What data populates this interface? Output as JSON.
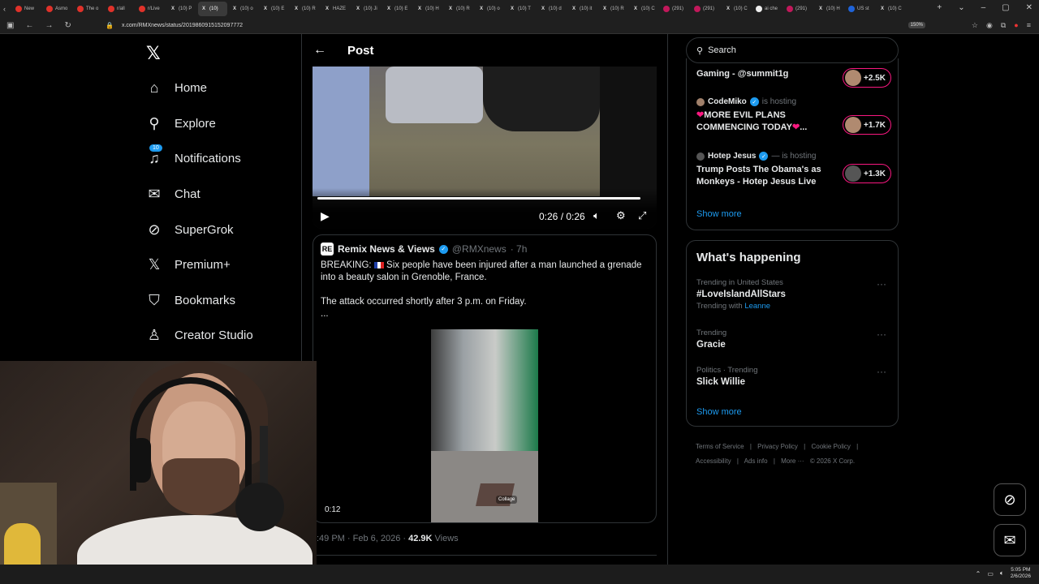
{
  "browser": {
    "tabs": [
      {
        "label": "New",
        "fav": "red"
      },
      {
        "label": "Asmo",
        "fav": "red"
      },
      {
        "label": "The o",
        "fav": "red"
      },
      {
        "label": "r/all",
        "fav": "red"
      },
      {
        "label": "r/Live",
        "fav": "red"
      },
      {
        "label": "(10) P",
        "fav": "x"
      },
      {
        "label": "(10)",
        "fav": "x",
        "active": true
      },
      {
        "label": "(10) o",
        "fav": "x"
      },
      {
        "label": "(10) E",
        "fav": "x"
      },
      {
        "label": "(10) R",
        "fav": "x"
      },
      {
        "label": "HAZE",
        "fav": "x"
      },
      {
        "label": "(10) Ji",
        "fav": "x"
      },
      {
        "label": "(10) E",
        "fav": "x"
      },
      {
        "label": "(10) H",
        "fav": "x"
      },
      {
        "label": "(10) R",
        "fav": "x"
      },
      {
        "label": "(10) o",
        "fav": "x"
      },
      {
        "label": "(10) T",
        "fav": "x"
      },
      {
        "label": "(10) d",
        "fav": "x"
      },
      {
        "label": "(10) it",
        "fav": "x"
      },
      {
        "label": "(10) R",
        "fav": "x"
      },
      {
        "label": "(10) C",
        "fav": "x"
      },
      {
        "label": "(291)",
        "fav": "pink"
      },
      {
        "label": "(291)",
        "fav": "pink"
      },
      {
        "label": "(10) C",
        "fav": "x"
      },
      {
        "label": "ai che",
        "fav": "g"
      },
      {
        "label": "(291)",
        "fav": "pink"
      },
      {
        "label": "(10) H",
        "fav": "x"
      },
      {
        "label": "US st",
        "fav": "blue"
      },
      {
        "label": "(10) C",
        "fav": "x"
      }
    ],
    "url": "x.com/RMXnews/status/2019860915152097772",
    "zoom": "150%"
  },
  "leftnav": {
    "logo": "𝕏",
    "items": [
      {
        "label": "Home",
        "icon": "⌂"
      },
      {
        "label": "Explore",
        "icon": "⚲"
      },
      {
        "label": "Notifications",
        "icon": "🔔",
        "badge": "10"
      },
      {
        "label": "Chat",
        "icon": "✉"
      },
      {
        "label": "SuperGrok",
        "icon": "⊘"
      },
      {
        "label": "Premium+",
        "icon": "𝕏"
      },
      {
        "label": "Bookmarks",
        "icon": "🔖"
      },
      {
        "label": "Creator Studio",
        "icon": "♙"
      }
    ]
  },
  "post": {
    "header_title": "Post",
    "video_time": "0:26 / 0:26",
    "video_progress": 1.0,
    "quote": {
      "avatar": "RE",
      "author": "Remix News & Views",
      "handle": "@RMXnews",
      "age": "· 7h",
      "text_1": "BREAKING: ",
      "text_2": " Six people have been injured after a man launched a grenade into a beauty salon in Grenoble, France.",
      "text_3": "The attack occurred shortly after 3 p.m. on Friday.",
      "text_4": "...",
      "video_time": "0:12",
      "video_watermark": "Collage"
    },
    "meta_time": ":49 PM · Feb 6, 2026 · ",
    "views_count": "42.9K",
    "views_label": " Views"
  },
  "right": {
    "search_placeholder": "Search",
    "live": [
      {
        "host": "",
        "status": "",
        "title": "Gaming - @summit1g",
        "count": "+2.5K"
      },
      {
        "host": "CodeMiko",
        "status": "is hosting",
        "title": "MORE EVIL PLANS COMMENCING TODAY",
        "count": "+1.7K"
      },
      {
        "host": "Hotep Jesus",
        "status": "— is hosting",
        "title": "Trump Posts The Obama's as Monkeys - Hotep Jesus Live",
        "count": "+1.3K"
      }
    ],
    "show_more": "Show more",
    "happening_title": "What's happening",
    "trends": [
      {
        "context": "Trending in United States",
        "name": "#LoveIslandAllStars",
        "with_label": "Trending with",
        "with_value": "Leanne"
      },
      {
        "context": "Trending",
        "name": "Gracie"
      },
      {
        "context": "Politics · Trending",
        "name": "Slick Willie"
      }
    ],
    "footer": [
      "Terms of Service",
      "|",
      "Privacy Policy",
      "|",
      "Cookie Policy",
      "|",
      "Accessibility",
      "|",
      "Ads info",
      "|",
      "More ···",
      "© 2026 X Corp."
    ]
  },
  "taskbar": {
    "time": "5:05 PM",
    "date": "2/6/2026"
  }
}
